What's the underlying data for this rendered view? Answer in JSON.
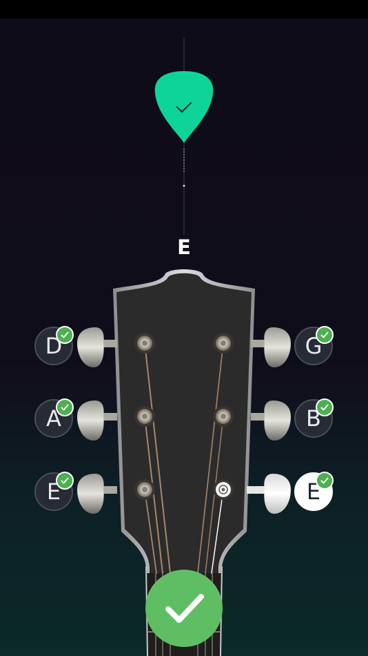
{
  "tuner": {
    "current_note": "E",
    "pick_color": "#0fd49a",
    "in_tune": true
  },
  "strings": {
    "left": [
      {
        "note": "D",
        "tuned": true
      },
      {
        "note": "A",
        "tuned": true
      },
      {
        "note": "E",
        "tuned": true
      }
    ],
    "right": [
      {
        "note": "G",
        "tuned": true
      },
      {
        "note": "B",
        "tuned": true
      },
      {
        "note": "E",
        "tuned": true,
        "selected": true
      }
    ]
  },
  "colors": {
    "check_green": "#4caf50",
    "done_green": "#5fbe63",
    "headstock": "#2a2a2a"
  },
  "icons": {
    "pick": "guitar-pick-icon",
    "check": "check-icon",
    "done": "checkmark-icon"
  }
}
